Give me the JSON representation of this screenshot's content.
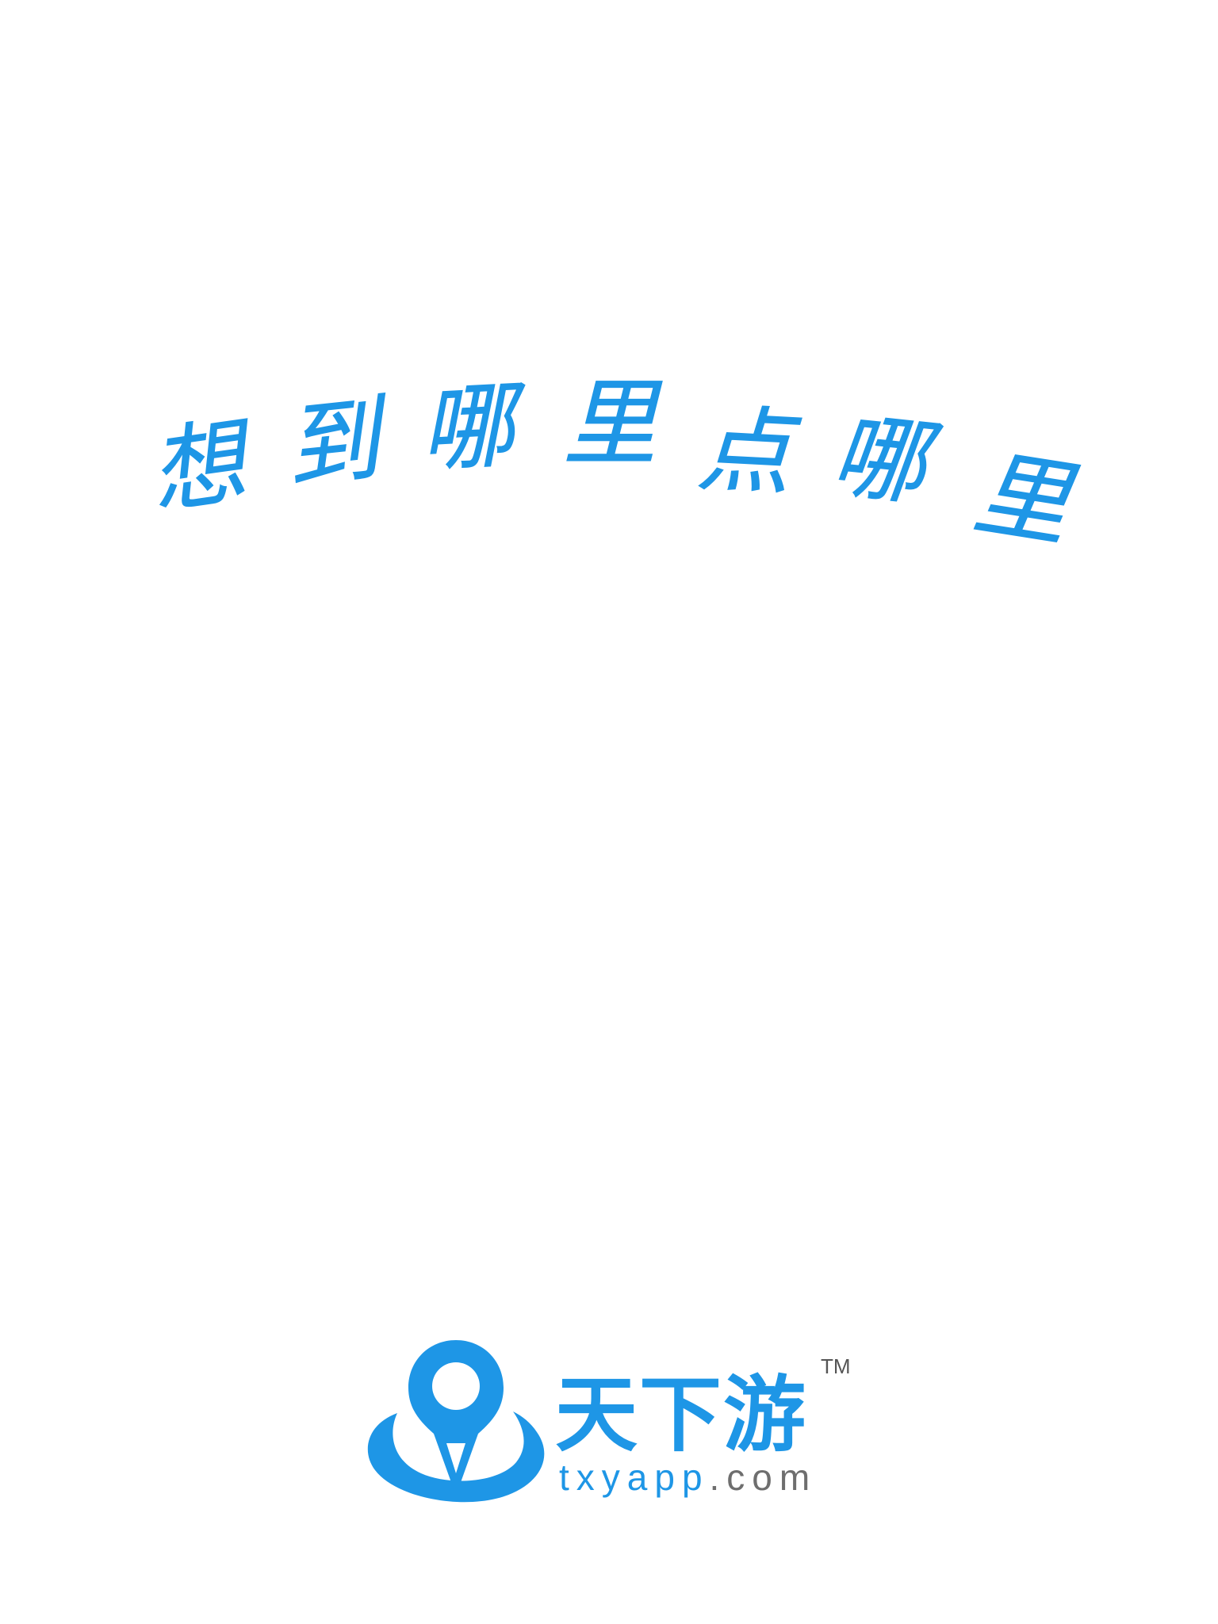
{
  "slogan": {
    "chars": [
      "想",
      "到",
      "哪",
      "里",
      "点",
      "哪",
      "里"
    ]
  },
  "brand": {
    "name": "天下游",
    "trademark": "TM",
    "domain_main": "txyapp",
    "domain_suffix": ".com",
    "icon": "location-pin-icon",
    "color_primary": "#1e96e6",
    "color_secondary": "#6e6e6e"
  }
}
